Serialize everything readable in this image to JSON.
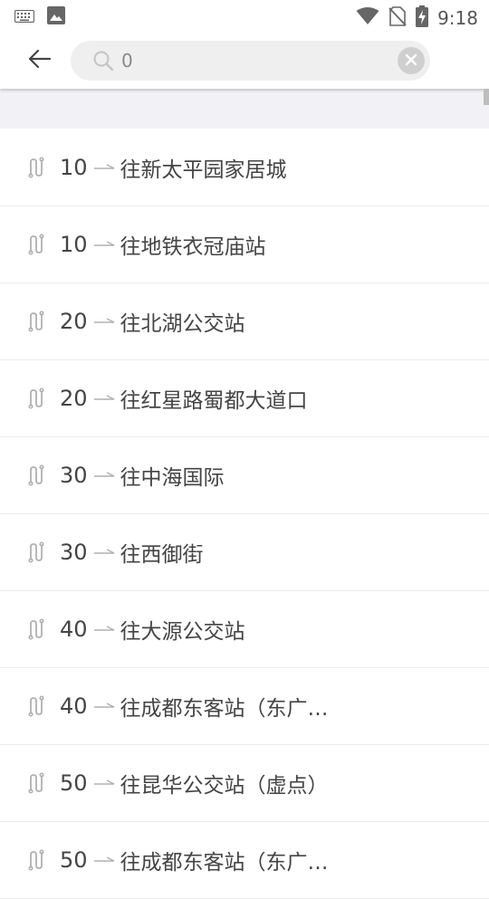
{
  "status_bar": {
    "time": "9:18",
    "icons": [
      "keyboard-icon",
      "image-icon",
      "wifi-icon",
      "no-sim-icon",
      "battery-charging-icon"
    ]
  },
  "header": {
    "back_icon": "arrow-left-icon",
    "search": {
      "value": "0",
      "icon": "search-icon",
      "clear_icon": "close-icon"
    }
  },
  "routes": [
    {
      "number": "10",
      "destination": "往新太平园家居城"
    },
    {
      "number": "10",
      "destination": "往地铁衣冠庙站"
    },
    {
      "number": "20",
      "destination": "往北湖公交站"
    },
    {
      "number": "20",
      "destination": "往红星路蜀都大道口"
    },
    {
      "number": "30",
      "destination": "往中海国际"
    },
    {
      "number": "30",
      "destination": "往西御街"
    },
    {
      "number": "40",
      "destination": "往大源公交站"
    },
    {
      "number": "40",
      "destination": "往成都东客站（东广…"
    },
    {
      "number": "50",
      "destination": "往昆华公交站（虚点）"
    },
    {
      "number": "50",
      "destination": "往成都东客站（东广…"
    }
  ],
  "colors": {
    "search_bg": "#efefef",
    "band_bg": "#f2f2f6",
    "icon_gray": "#b0b0b0"
  }
}
